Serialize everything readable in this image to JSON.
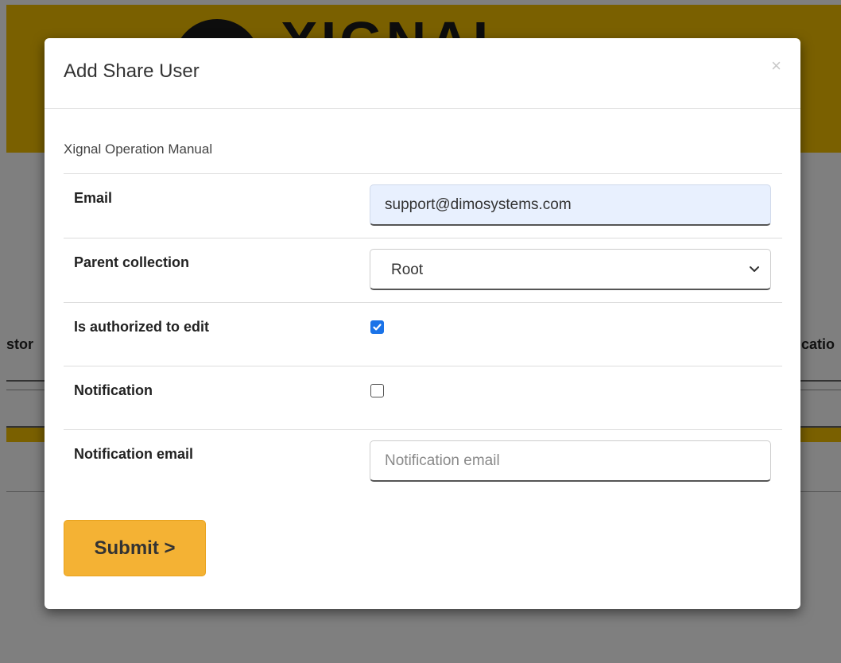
{
  "background": {
    "logo_text": "XIGNAL",
    "tab_left_fragment": "stor",
    "tab_right_fragment": "icatio"
  },
  "modal": {
    "title": "Add Share User",
    "close_symbol": "×",
    "subtitle": "Xignal Operation Manual",
    "fields": {
      "email": {
        "label": "Email",
        "value": "support@dimosystems.com"
      },
      "parent_collection": {
        "label": "Parent collection",
        "selected": "Root"
      },
      "authorized": {
        "label": "Is authorized to edit",
        "checked": true
      },
      "notification": {
        "label": "Notification",
        "checked": false
      },
      "notification_email": {
        "label": "Notification email",
        "value": "",
        "placeholder": "Notification email"
      }
    },
    "submit_label": "Submit >"
  },
  "colors": {
    "brand_yellow": "#f5c100",
    "button_orange": "#f4b234",
    "checkbox_blue": "#1a73e8",
    "autofill_bg": "#e8f0fe"
  }
}
